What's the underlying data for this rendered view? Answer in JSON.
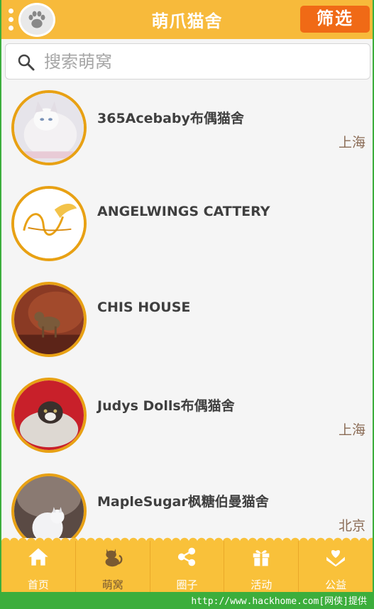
{
  "header": {
    "title": "萌爪猫舍",
    "filter_label": "筛选",
    "logo_icon": "paw-icon"
  },
  "search": {
    "placeholder": "搜索萌窝",
    "value": ""
  },
  "catteries": [
    {
      "name": "365Acebaby布偶猫舍",
      "city": "上海"
    },
    {
      "name": "ANGELWINGS CATTERY",
      "city": ""
    },
    {
      "name": "CHIS HOUSE",
      "city": ""
    },
    {
      "name": "Judys Dolls布偶猫舍",
      "city": "上海"
    },
    {
      "name": "MapleSugar枫糖伯曼猫舍",
      "city": "北京"
    }
  ],
  "bottom_nav": [
    {
      "label": "首页",
      "icon": "home-icon",
      "active": false
    },
    {
      "label": "萌窝",
      "icon": "cat-icon",
      "active": true
    },
    {
      "label": "圈子",
      "icon": "share-icon",
      "active": false
    },
    {
      "label": "活动",
      "icon": "gift-icon",
      "active": false
    },
    {
      "label": "公益",
      "icon": "heart-hands-icon",
      "active": false
    }
  ],
  "watermark": "http://www.hackhome.com[网侠]提供",
  "colors": {
    "header_bg": "#f7ba3b",
    "filter_button": "#f06a16",
    "avatar_ring": "#e8a114",
    "nav_bg": "#f9c13a"
  }
}
